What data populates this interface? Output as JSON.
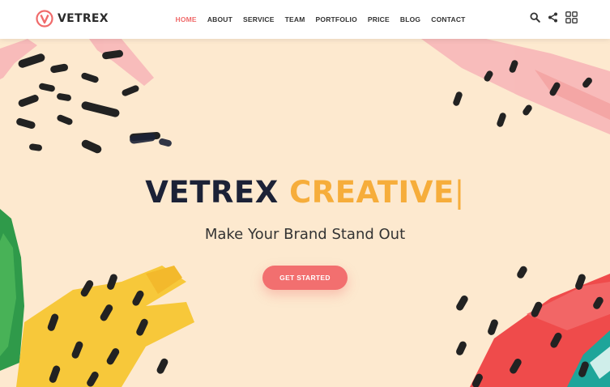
{
  "brand": {
    "name": "VETREX",
    "logo_icon": "v-logo-icon",
    "accent": "#f06b6b"
  },
  "nav": {
    "items": [
      {
        "label": "HOME",
        "active": true
      },
      {
        "label": "ABOUT",
        "active": false
      },
      {
        "label": "SERVICE",
        "active": false
      },
      {
        "label": "TEAM",
        "active": false
      },
      {
        "label": "PORTFOLIO",
        "active": false
      },
      {
        "label": "PRICE",
        "active": false
      },
      {
        "label": "BLOG",
        "active": false
      },
      {
        "label": "CONTACT",
        "active": false
      }
    ]
  },
  "header_icons": [
    "search-icon",
    "share-icon",
    "grid-menu-icon"
  ],
  "hero": {
    "headline_part1": "VETREX",
    "headline_part2": "CREATIVE",
    "cursor": "|",
    "subtitle": "Make Your Brand Stand Out",
    "cta_label": "GET STARTED",
    "colors": {
      "background": "#fde9cf",
      "headline_dark": "#1c2237",
      "headline_accent": "#f6ad3b",
      "cta": "#f26f6f",
      "pink_stroke": "#f8b9b9",
      "yellow_stroke": "#f7c83a",
      "green_stroke": "#2f9a4a",
      "red_stroke": "#ef4b4b",
      "teal_stroke": "#1ea59a",
      "dots": "#222222"
    }
  }
}
